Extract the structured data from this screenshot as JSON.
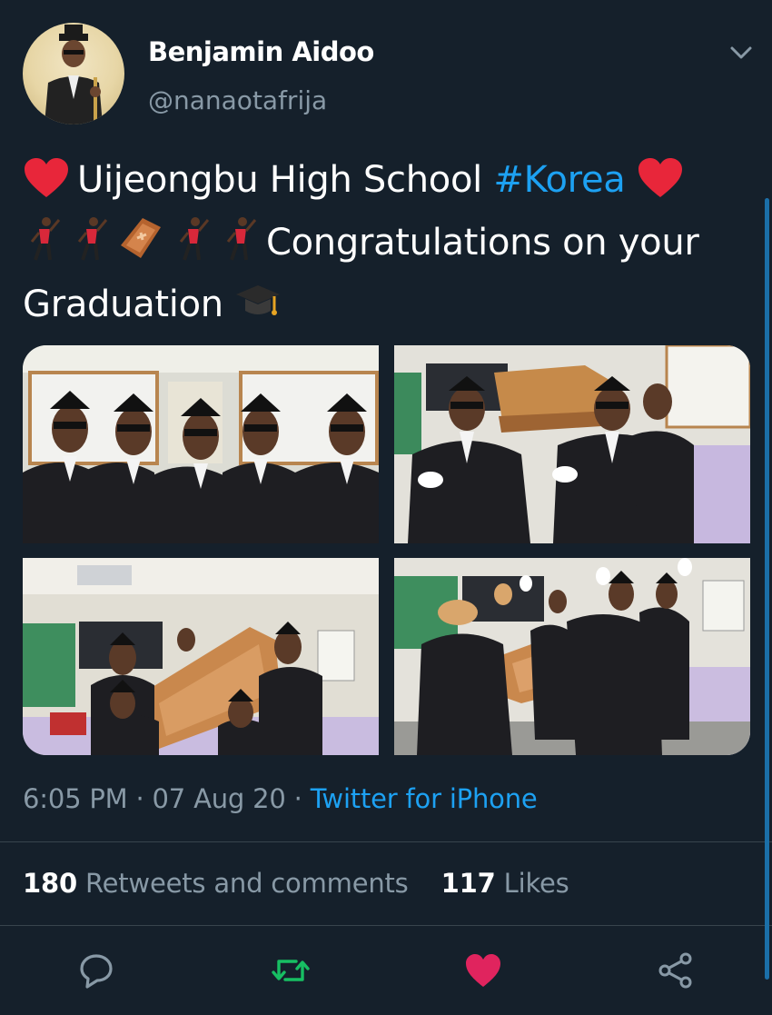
{
  "author": {
    "name": "Benjamin Aidoo",
    "handle": "@nanaotafrija"
  },
  "tweet": {
    "line1_text": "Uijeongbu High School",
    "hashtag": "#Korea",
    "line2_text": "Congratulations on your",
    "line3_text": "Graduation",
    "emoji": [
      "heart-emoji",
      "dancer-emoji",
      "coffin-emoji",
      "graduation-cap-emoji"
    ]
  },
  "photos": [
    {
      "name": "photo-group-pallbearers"
    },
    {
      "name": "photo-carrying-coffin"
    },
    {
      "name": "photo-classroom-coffin"
    },
    {
      "name": "photo-dancing-coffin"
    }
  ],
  "meta": {
    "time": "6:05 PM",
    "sep1": "·",
    "date": "07 Aug 20",
    "sep2": "·",
    "source": "Twitter for iPhone"
  },
  "stats": {
    "retweets_count": "180",
    "retweets_label": "Retweets and comments",
    "likes_count": "117",
    "likes_label": "Likes"
  },
  "colors": {
    "background": "#15202b",
    "accent": "#1da1f2",
    "muted": "#8899a6",
    "like": "#e0245e",
    "retweet": "#17bf63"
  },
  "actions": [
    "reply-icon",
    "retweet-icon",
    "like-icon",
    "share-icon"
  ]
}
